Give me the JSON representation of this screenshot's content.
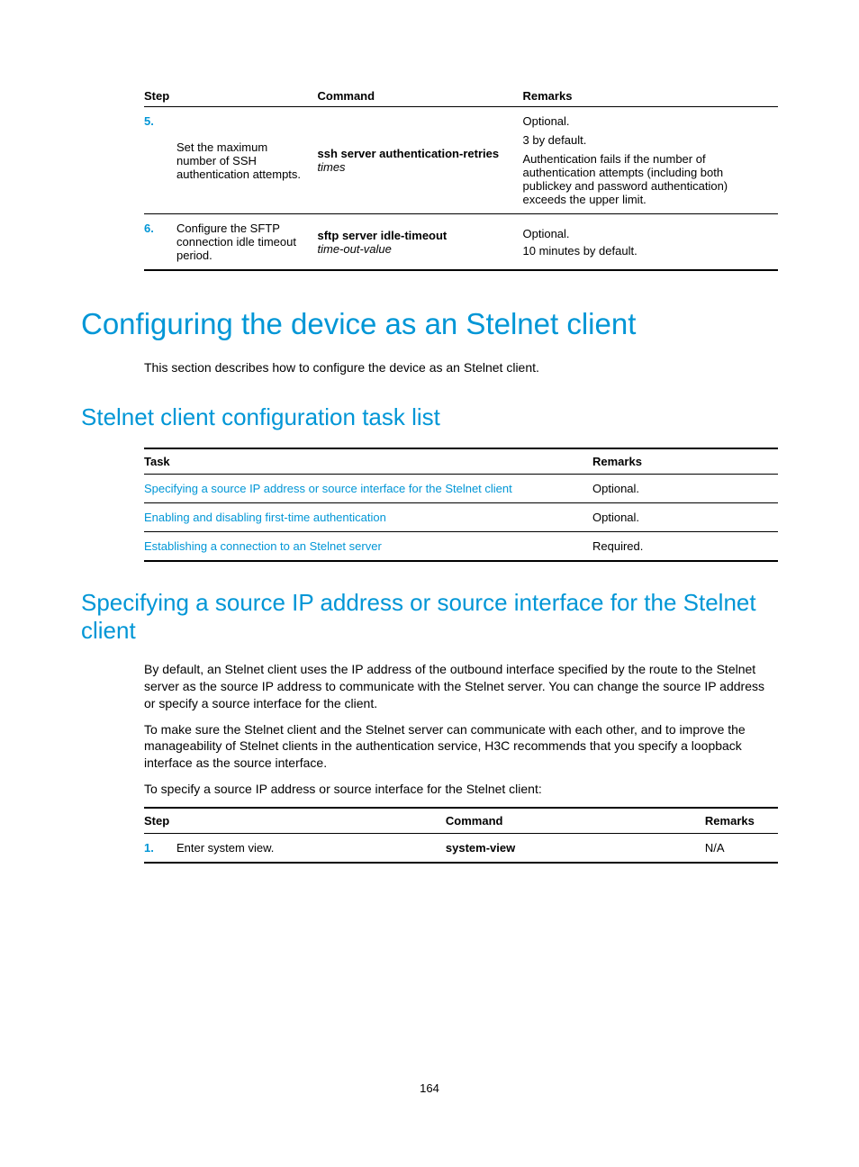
{
  "page_number": "164",
  "table1": {
    "headers": [
      "Step",
      "Command",
      "Remarks"
    ],
    "rows": [
      {
        "num": "5.",
        "step": "Set the maximum number of SSH authentication attempts.",
        "cmd_bold": "ssh server authentication-retries",
        "cmd_italic": "times",
        "remarks_l1": "Optional.",
        "remarks_l2": "3 by default.",
        "remarks_l3": "Authentication fails if the number of authentication attempts (including both publickey and password authentication) exceeds the upper limit."
      },
      {
        "num": "6.",
        "step": "Configure the SFTP connection idle timeout period.",
        "cmd_bold": "sftp server idle-timeout",
        "cmd_italic": "time-out-value",
        "remarks_l1": "Optional.",
        "remarks_l2": "10 minutes by default."
      }
    ]
  },
  "h1": "Configuring the device as an Stelnet client",
  "p1": "This section describes how to configure the device as an Stelnet client.",
  "h2a": "Stelnet client configuration task list",
  "table2": {
    "headers": [
      "Task",
      "Remarks"
    ],
    "rows": [
      {
        "task": "Specifying a source IP address or source interface for the Stelnet client",
        "remarks": "Optional."
      },
      {
        "task": "Enabling and disabling first-time authentication",
        "remarks": "Optional."
      },
      {
        "task": "Establishing a connection to an Stelnet server",
        "remarks": "Required."
      }
    ]
  },
  "h2b": "Specifying a source IP address or source interface for the Stelnet client",
  "p2": "By default, an Stelnet client uses the IP address of the outbound interface specified by the route to the Stelnet server as the source IP address to communicate with the Stelnet server. You can change the source IP address or specify a source interface for the client.",
  "p3": "To make sure the Stelnet client and the Stelnet server can communicate with each other, and to improve the manageability of Stelnet clients in the authentication service, H3C recommends that you specify a loopback interface as the source interface.",
  "p4": "To specify a source IP address or source interface for the Stelnet client:",
  "table3": {
    "headers": [
      "Step",
      "Command",
      "Remarks"
    ],
    "row": {
      "num": "1.",
      "step": "Enter system view.",
      "cmd": "system-view",
      "remarks": "N/A"
    }
  }
}
